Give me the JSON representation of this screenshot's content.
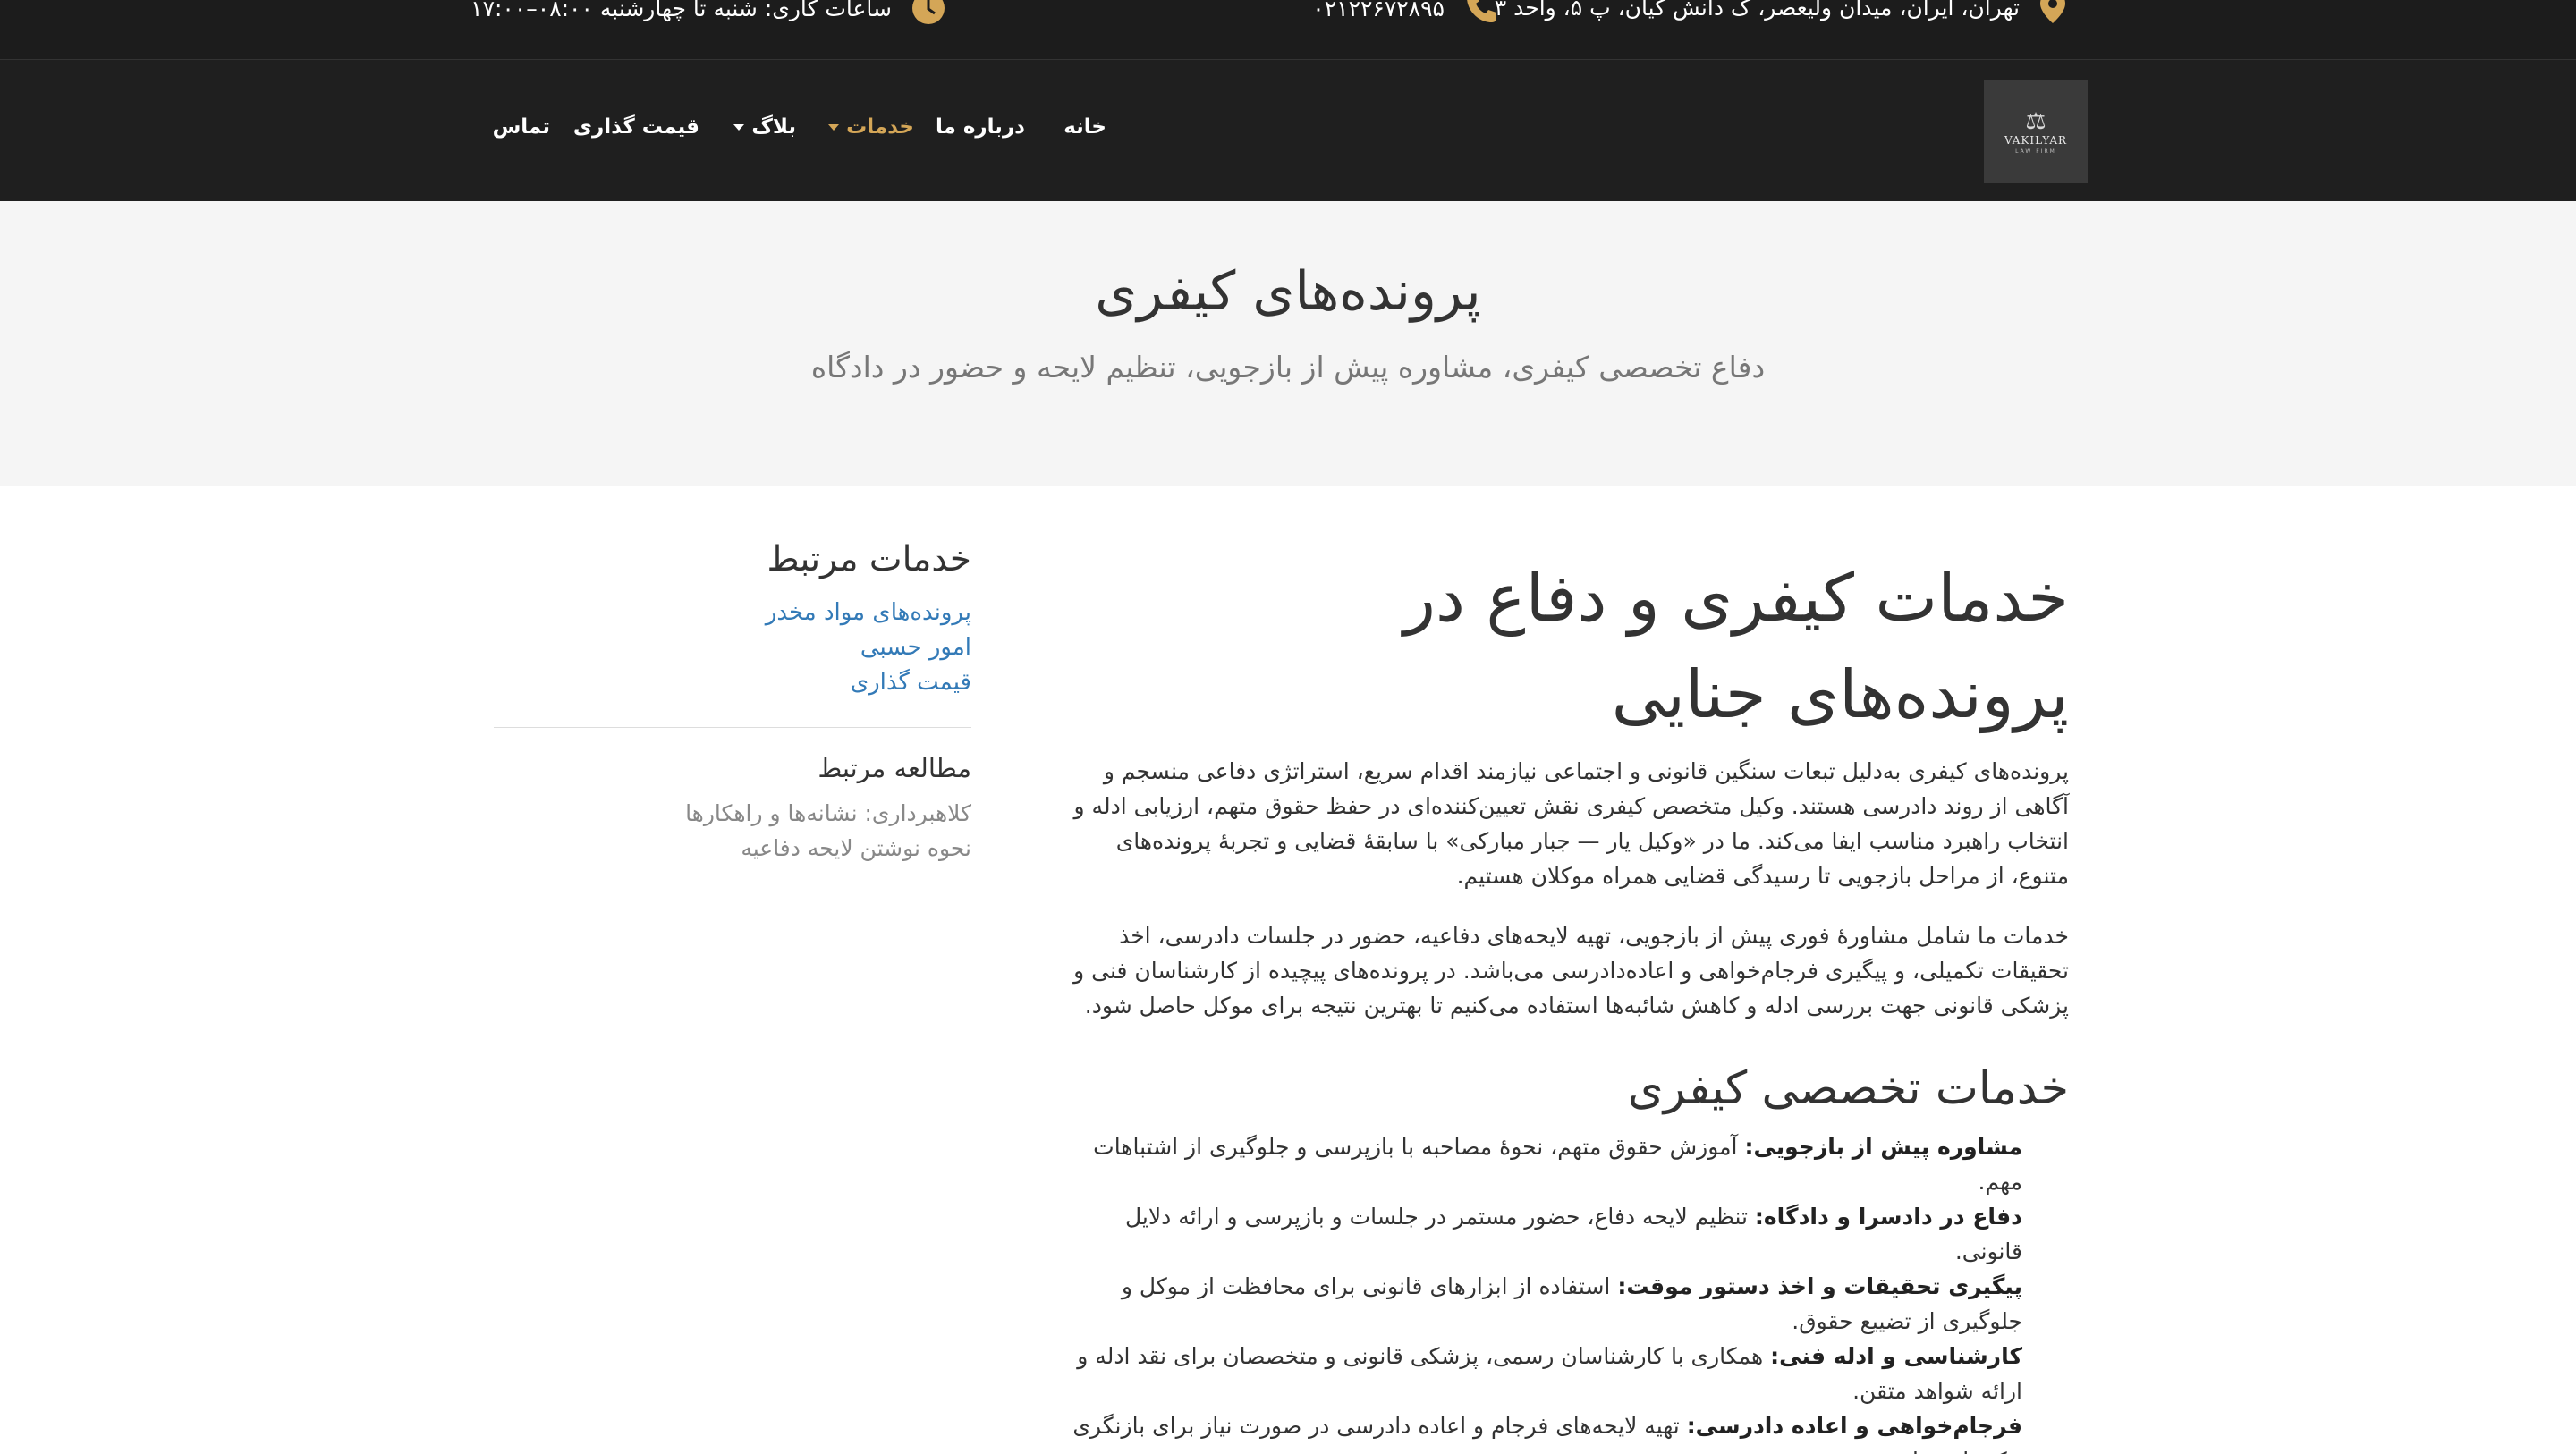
{
  "topbar": {
    "address": "تهران، ایران، میدان ولیعصر، ک دانش کیان، پ ۵، واحد ۳",
    "phone": "۰۲۱۲۲۶۷۲۸۹۵",
    "hours": "ساعات کاری: شنبه تا چهارشنبه ۰۸:۰۰–۱۷:۰۰",
    "accent_color": "#d4a657"
  },
  "logo": {
    "symbol": "⚖",
    "brand": "VAKILYAR",
    "tagline": "LAW FIRM"
  },
  "nav": {
    "home": "خانه",
    "about": "درباره ما",
    "services": "خدمات",
    "blog": "بلاگ",
    "pricing": "قیمت گذاری",
    "contact": "تماس"
  },
  "hero": {
    "title": "پرونده‌های کیفری",
    "subtitle": "دفاع تخصصی کیفری، مشاوره پیش از بازجویی، تنظیم لایحه و حضور در دادگاه"
  },
  "main": {
    "heading_line1": "خدمات کیفری و دفاع در",
    "heading_line2": "پرونده‌های جنایی",
    "para1": "پرونده‌های کیفری به‌دلیل تبعات سنگین قانونی و اجتماعی نیازمند اقدام سریع، استراتژی دفاعی منسجم و آگاهی از روند دادرسی هستند. وکیل متخصص کیفری نقش تعیین‌کننده‌ای در حفظ حقوق متهم، ارزیابی ادله و انتخاب راهبرد مناسب ایفا می‌کند. ما در «وکیل یار — جبار مبارکی» با سابقهٔ قضایی و تجربهٔ پرونده‌های متنوع، از مراحل بازجویی تا رسیدگی قضایی همراه موکلان هستیم.",
    "para2": "خدمات ما شامل مشاورهٔ فوری پیش از بازجویی، تهیه لایحه‌های دفاعیه، حضور در جلسات دادرسی، اخذ تحقیقات تکمیلی، و پیگیری فرجام‌خواهی و اعاده‌دادرسی می‌باشد. در پرونده‌های پیچیده از کارشناسان فنی و پزشکی قانونی جهت بررسی ادله و کاهش شائبه‌ها استفاده می‌کنیم تا بهترین نتیجه برای موکل حاصل شود.",
    "services_heading": "خدمات تخصصی کیفری",
    "services": [
      {
        "title": "مشاوره پیش از بازجویی:",
        "text": " آموزش حقوق متهم، نحوهٔ مصاحبه با بازپرسی و جلوگیری از اشتباهات مهم."
      },
      {
        "title": "دفاع در دادسرا و دادگاه:",
        "text": " تنظیم لایحه دفاع، حضور مستمر در جلسات و بازپرسی و ارائه دلایل قانونی."
      },
      {
        "title": "پیگیری تحقیقات و اخذ دستور موقت:",
        "text": " استفاده از ابزارهای قانونی برای محافظت از موکل و جلوگیری از تضییع حقوق."
      },
      {
        "title": "کارشناسی و ادله فنی:",
        "text": " همکاری با کارشناسان رسمی، پزشکی قانونی و متخصصان برای نقد ادله و ارائه شواهد متقن."
      },
      {
        "title": "فرجام‌خواهی و اعاده دادرسی:",
        "text": " تهیه لایحه‌های فرجام و اعاده دادرسی در صورت نیاز برای بازنگری حکم‌های صادره."
      }
    ]
  },
  "sidebar": {
    "related_services_title": "خدمات مرتبط",
    "related_services": [
      "پرونده‌های مواد مخدر",
      "امور حسبی",
      "قیمت گذاری"
    ],
    "related_reading_title": "مطالعه مرتبط",
    "related_reading": [
      "کلاهبرداری: نشانه‌ها و راهکارها",
      "نحوه نوشتن لایحه دفاعیه"
    ],
    "link_color": "#337ab7"
  }
}
